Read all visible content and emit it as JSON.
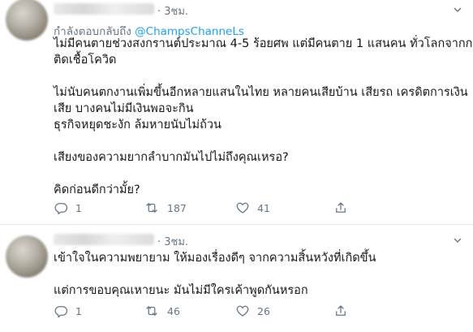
{
  "tweets": [
    {
      "time": "· 3ชม.",
      "replying_prefix": "กำลังตอบกลับถึง",
      "replying_to": "@ChampsChanneLs",
      "lines": [
        "ไม่มีคนตายช่วงสงกรานต์ประมาณ 4-5 ร้อยศพ แต่มีคนตาย 1 แสนคน ทั่วโลกจากการ",
        "ติดเชื้อโควิด",
        "",
        "ไม่นับคนตกงานเพิ่มขึ้นอีกหลายแสนในไทย หลายคนเสียบ้าน เสียรถ เครดิตการเงิน",
        "เสีย บางคนไม่มีเงินพอจะกิน",
        "ธุรกิจหยุดชะงัก ล้มหายนับไม่ถ้วน",
        "",
        "เสียงของความยากลำบากมันไปไม่ถึงคุณเหรอ?",
        "",
        "คิดก่อนดีกว่ามั้ย?"
      ],
      "reply_count": "1",
      "retweet_count": "187",
      "like_count": "41"
    },
    {
      "time": "· 3ชม.",
      "lines": [
        "เข้าใจในความพยายาม ให้มองเรื่องดีๆ จากความสิ้นหวังที่เกิดขึ้น",
        "",
        "แต่การขอบคุณเหายนะ มันไม่มีใครเค้าพูดกันหรอก"
      ],
      "reply_count": "1",
      "retweet_count": "46",
      "like_count": "26"
    }
  ],
  "icons": {
    "reply": "reply-icon",
    "retweet": "retweet-icon",
    "like": "like-icon",
    "share": "share-icon",
    "more": "chevron-down-icon"
  },
  "colors": {
    "text": "#14171a",
    "muted": "#657786",
    "link": "#1da1f2",
    "divider": "#e6ecf0"
  }
}
